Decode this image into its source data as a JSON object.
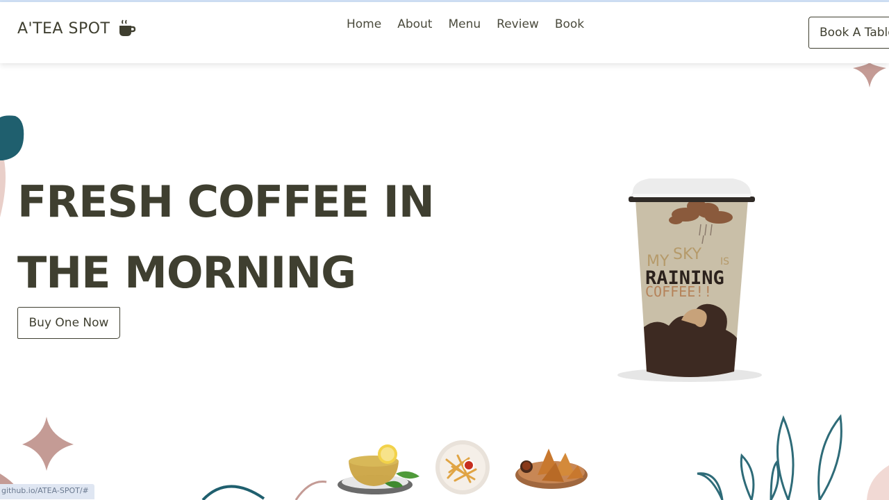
{
  "brand": {
    "name": "A'TEA SPOT",
    "icon": "coffee-cup-icon"
  },
  "nav": {
    "items": [
      {
        "label": "Home"
      },
      {
        "label": "About"
      },
      {
        "label": "Menu"
      },
      {
        "label": "Review"
      },
      {
        "label": "Book"
      }
    ]
  },
  "header": {
    "cta_label": "Book A Table"
  },
  "hero": {
    "line1": "FRESH COFFEE IN",
    "line2": "THE MORNING",
    "button_label": "Buy One Now",
    "cup_text": [
      "MY",
      "SKY",
      "IS",
      "RAINING",
      "COFFEE!!"
    ]
  },
  "thumbnails": [
    {
      "name": "green-tea"
    },
    {
      "name": "french-fries"
    },
    {
      "name": "samosas"
    }
  ],
  "status_bar": {
    "url": "github.io/ATEA-SPOT/#"
  },
  "colors": {
    "text": "#3f3f30",
    "teal": "#1f5f6e",
    "rose": "#c49b95",
    "leaf": "#2e6b78"
  }
}
